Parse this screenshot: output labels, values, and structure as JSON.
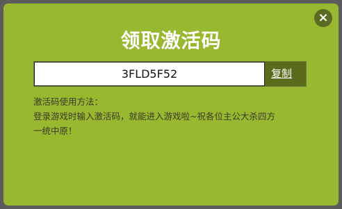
{
  "dialog": {
    "title": "领取激活码",
    "close_icon": "×",
    "code_value": "3FLD5F52",
    "copy_label": "复制",
    "instructions": {
      "heading": "激活码使用方法：",
      "line1": "登录游戏时输入激活码，就能进入游戏啦~祝各位主公大杀四方",
      "line2": "一统中原！"
    }
  },
  "colors": {
    "background": "#97b82f",
    "border": "#5c5c5c",
    "button": "#5b6b1c",
    "text": "#3c3a2a"
  }
}
